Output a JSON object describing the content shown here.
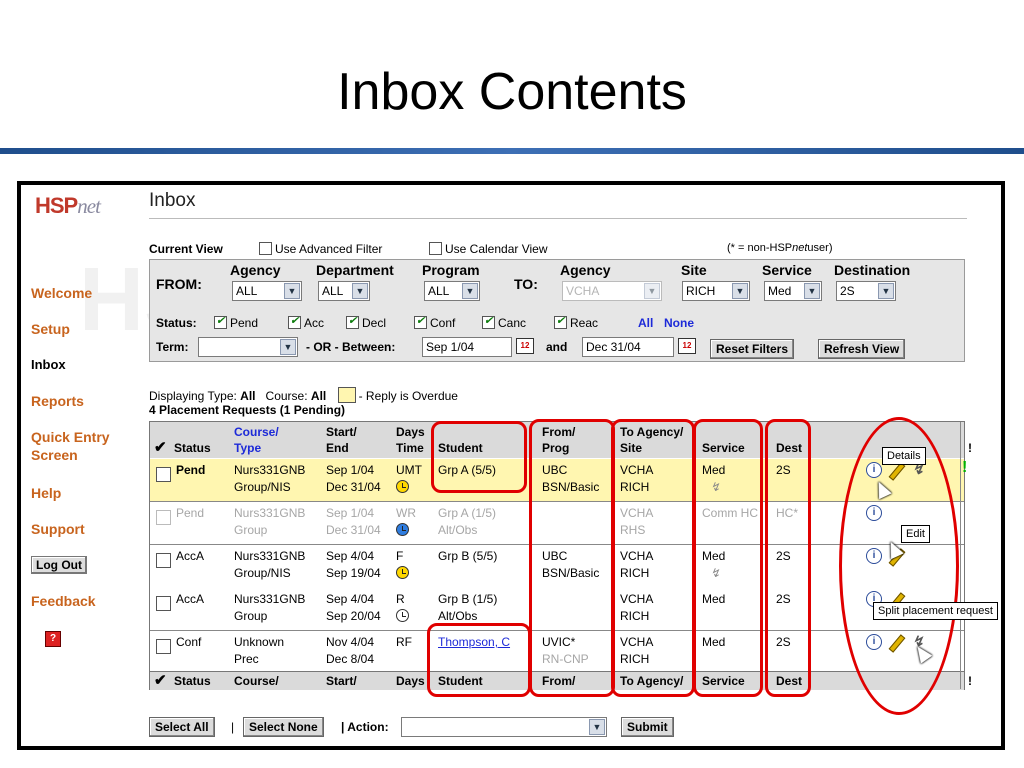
{
  "slide": {
    "title": "Inbox Contents"
  },
  "nav": {
    "logo_hsp": "HSP",
    "logo_net": "net",
    "items": [
      "Welcome",
      "Setup",
      "Inbox",
      "Reports",
      "Quick Entry",
      "Screen",
      "Help",
      "Support"
    ],
    "logout": "Log Out",
    "feedback": "Feedback"
  },
  "inbox": {
    "title": "Inbox",
    "current_view": "Current View",
    "advanced_filter": "Use Advanced Filter",
    "calendar_view": "Use Calendar View",
    "non_user_note": "(* = non-HSP",
    "non_user_net": "net",
    "non_user_tail": "user)"
  },
  "filter": {
    "from_label": "FROM:",
    "to_label": "TO:",
    "agency_label": "Agency",
    "department_label": "Department",
    "program_label": "Program",
    "to_agency_label": "Agency",
    "site_label": "Site",
    "service_label": "Service",
    "destination_label": "Destination",
    "agency_value": "ALL",
    "department_value": "ALL",
    "program_value": "ALL",
    "to_agency_value": "VCHA",
    "site_value": "RICH",
    "service_value": "Med",
    "destination_value": "2S",
    "status_label": "Status:",
    "statuses": [
      "Pend",
      "Acc",
      "Decl",
      "Conf",
      "Canc",
      "Reac"
    ],
    "all_link": "All",
    "none_link": "None",
    "term_label": "Term:",
    "or_between": "- OR - Between:",
    "start_date": "Sep 1/04",
    "and_label": "and",
    "end_date": "Dec 31/04",
    "reset_button": "Reset Filters",
    "refresh_button": "Refresh View"
  },
  "display": {
    "displaying_type_label": "Displaying Type:",
    "displaying_type_value": "All",
    "course_label": "Course:",
    "course_value": "All",
    "overdue_text": "- Reply is Overdue",
    "count_text": "4 Placement Requests (1 Pending)"
  },
  "table": {
    "headers": {
      "status": "Status",
      "course": "Course/",
      "type": "Type",
      "start": "Start/",
      "end": "End",
      "days": "Days",
      "time": "Time",
      "student": "Student",
      "from": "From/",
      "prog": "Prog",
      "to_agency": "To Agency/",
      "site": "Site",
      "service": "Service",
      "dest": "Dest",
      "flag": "!"
    },
    "rows": [
      {
        "status": "Pend",
        "course": "Nurs331GNB",
        "type": "Group/NIS",
        "start": "Sep 1/04",
        "end": "Dec 31/04",
        "days": "UMT",
        "student": "Grp A (5/5)",
        "from": "UBC",
        "prog": "BSN/Basic",
        "to_agency": "VCHA",
        "site": "RICH",
        "service": "Med",
        "dest": "2S"
      },
      {
        "status": "Pend",
        "course": "Nurs331GNB",
        "type": "Group",
        "start": "Sep 1/04",
        "end": "Dec 31/04",
        "days": "WR",
        "student": "Grp A (1/5)",
        "student2": "Alt/Obs",
        "from": "",
        "prog": "",
        "to_agency": "VCHA",
        "site": "RHS",
        "service": "Comm HC",
        "dest": "HC*"
      },
      {
        "status": "AccA",
        "course": "Nurs331GNB",
        "type": "Group/NIS",
        "start": "Sep 4/04",
        "end": "Sep 19/04",
        "days": "F",
        "student": "Grp B (5/5)",
        "from": "UBC",
        "prog": "BSN/Basic",
        "to_agency": "VCHA",
        "site": "RICH",
        "service": "Med",
        "dest": "2S"
      },
      {
        "status": "AccA",
        "course": "Nurs331GNB",
        "type": "Group",
        "start": "Sep 4/04",
        "end": "Sep 20/04",
        "days": "R",
        "student": "Grp B (1/5)",
        "student2": "Alt/Obs",
        "from": "",
        "prog": "",
        "to_agency": "VCHA",
        "site": "RICH",
        "service": "Med",
        "dest": "2S"
      },
      {
        "status": "Conf",
        "course": "Unknown",
        "type": "Prec",
        "start": "Nov 4/04",
        "end": "Dec 8/04",
        "days": "RF",
        "student": "Thompson, C",
        "from": "UVIC*",
        "prog": "RN-CNP",
        "to_agency": "VCHA",
        "site": "RICH",
        "service": "Med",
        "dest": "2S"
      }
    ]
  },
  "actions": {
    "select_all": "Select All",
    "select_none": "Select None",
    "action_label": "| Action:",
    "submit": "Submit"
  },
  "annotations": {
    "details": "Details",
    "edit": "Edit",
    "split": "Split placement request"
  },
  "colors": {
    "accent_red": "#e00000",
    "nav_orange": "#c8641e",
    "link_blue": "#1d2ad8",
    "title_rule": "#2f5fa5"
  }
}
